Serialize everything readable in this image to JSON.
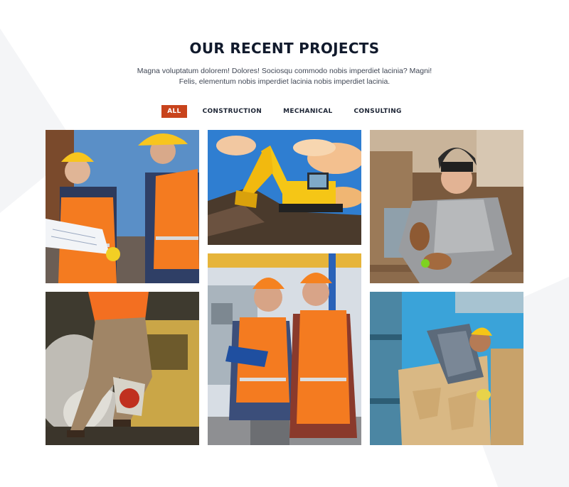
{
  "section": {
    "title": "OUR RECENT PROJECTS",
    "subtitle_line1": "Magna voluptatum dolorem! Dolores! Sociosqu commodo nobis imperdiet lacinia? Magni!",
    "subtitle_line2": "Felis, elementum nobis imperdiet lacinia nobis imperdiet lacinia."
  },
  "filters": {
    "all": "ALL",
    "construction": "CONSTRUCTION",
    "mechanical": "MECHANICAL",
    "consulting": "CONSULTING",
    "active": "all"
  },
  "projects": [
    {
      "image": "engineers-reviewing-plans",
      "category": "consulting"
    },
    {
      "image": "yellow-excavator",
      "category": "mechanical"
    },
    {
      "image": "welder-with-mask",
      "category": "mechanical"
    },
    {
      "image": "worker-cutting-concrete",
      "category": "construction"
    },
    {
      "image": "two-engineers-with-clipboard",
      "category": "consulting"
    },
    {
      "image": "worker-installing-panel",
      "category": "construction"
    }
  ],
  "colors": {
    "accent": "#c8431c",
    "heading": "#111a2c",
    "text": "#3f4654"
  }
}
